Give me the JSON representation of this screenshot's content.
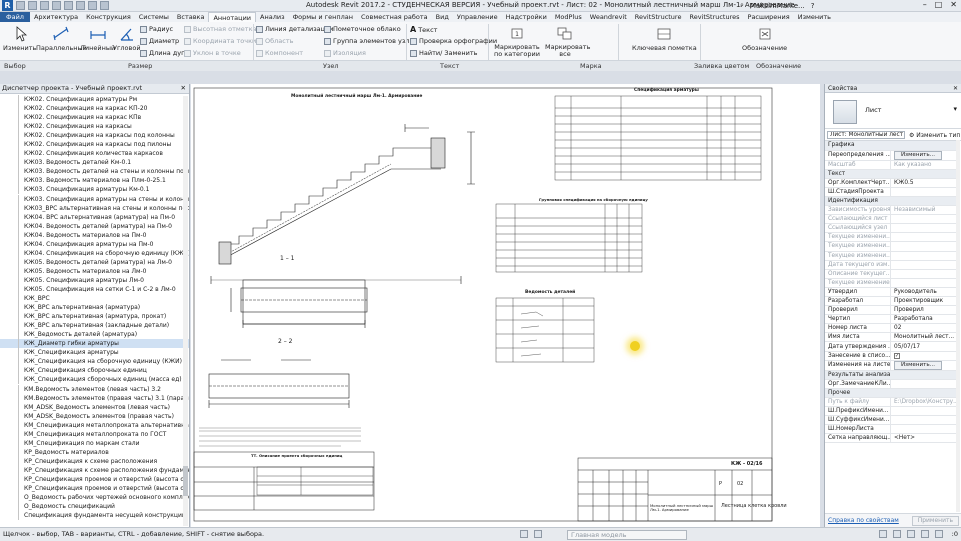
{
  "titlebar": {
    "title": "Autodesk Revit 2017.2 - СТУДЕНЧЕСКАЯ ВЕРСИЯ -    Учебный проект.rvt - Лист: 02 - Монолитный лестничный марш Лм-1. Армирование",
    "search_placeholder": "Введите ключевое слово или фразу",
    "user": "MaksimMarke...",
    "help": "?"
  },
  "tabs": [
    "Файл",
    "Архитектура",
    "Конструкция",
    "Системы",
    "Вставка",
    "Аннотации",
    "Анализ",
    "Формы и генплан",
    "Совместная работа",
    "Вид",
    "Управление",
    "Надстройки",
    "ModPlus",
    "Weandrevit",
    "RevitStructure",
    "RevitStructures",
    "Расширения",
    "Изменить"
  ],
  "active_tab": "Аннотации",
  "ribbon": {
    "modify": "Изменить",
    "parallel": "Параллельный",
    "linear": "Линейный",
    "angular": "Угловой",
    "radius": "Радиус",
    "diameter": "Диаметр",
    "arc_length": "Длина дуги",
    "spot_elevation": "Высотная отметка",
    "spot_coordinate": "Координата точки",
    "spot_slope": "Уклон в точке",
    "area": "Область",
    "component": "Компонент",
    "detail_line": "Линия детализации",
    "revision_cloud": "Пометочное облако",
    "detail_group": "Группа элементов узла",
    "insulation": "Изоляция",
    "text": "Текст",
    "spelling": "Проверка орфографии",
    "find_replace": "Найти/ Заменить",
    "tag_by_category": "Маркировать по категории",
    "tag_all": "Маркировать все",
    "keynote": "Ключевая пометка",
    "legend": "Обозначение"
  },
  "panels": [
    "Выбор",
    "Размер",
    "Узел",
    "Текст",
    "Марка",
    "Заливка цветом",
    "Обозначение"
  ],
  "browser": {
    "title": "Диспетчер проекта - Учебный проект.rvt",
    "selected_index": 27,
    "items": [
      "КЖ02. Спецификация арматуры Рм",
      "КЖ02. Спецификация на каркас КП-20",
      "КЖ02. Спецификация на каркас КПв",
      "КЖ02. Спецификация на каркасы",
      "КЖ02. Спецификация на каркасы под колонны",
      "КЖ02. Спецификация на каркасы под пилоны",
      "КЖ02. Спецификация количества каркасов",
      "КЖ03. Ведомость деталей Км-0.1",
      "КЖ03. Ведомость деталей на стены и колонны подвала",
      "КЖ03. Ведомость материалов на Плм-0-25.1",
      "КЖ03. Спецификация арматуры Км-0.1",
      "КЖ03. Спецификация арматуры на стены и колонны под",
      "КЖ03_ВРС альтернативная на стены и колонны подвал",
      "КЖ04. ВРС альтернативная (арматура) на Пм-0",
      "КЖ04. Ведомость деталей (арматура) на Пм-0",
      "КЖ04. Ведомость материалов на Пм-0",
      "КЖ04. Спецификация арматуры на Пм-0",
      "КЖ04. Спецификация на сборочную единицу (КЖИ) КР-",
      "КЖ05. Ведомость деталей (арматура) на Лм-0",
      "КЖ05. Ведомость материалов на Лм-0",
      "КЖ05. Спецификация арматуры Лм-0",
      "КЖ05. Спецификация на сетки С-1 и С-2 в Лм-0",
      "КЖ_ВРС",
      "КЖ_ВРС альтернативная (арматура)",
      "КЖ_ВРС альтернативная (арматура, прокат)",
      "КЖ_ВРС альтернативная (закладные детали)",
      "КЖ_Ведомость деталей (арматура)",
      "КЖ_Диаметр гибки арматуры",
      "КЖ_Спецификация арматуры",
      "КЖ_Спецификация на сборочную единицу (КЖИ)",
      "КЖ_Спецификация сборочных единиц",
      "КЖ_Спецификация сборочных единиц (масса ед)",
      "КМ.Ведомость элементов (левая часть) 3.2",
      "КМ.Ведомость элементов (правая часть) 3.1 (параметры",
      "КМ_ADSK_Ведомость элементов (левая часть)",
      "КМ_ADSK_Ведомость элементов (правая часть)",
      "КМ_Спецификация металлопроката альтернативная",
      "КМ_Спецификация металлопроката по ГОСТ",
      "КМ_Спецификация по маркам стали",
      "КР_Ведомость материалов",
      "КР_Спецификация к схеме расположения",
      "КР_Спецификация к схеме расположения фундаментов",
      "КР_Спецификация проемов и отверстий (высота от 0.000",
      "КР_Спецификация проемов и отверстий (высота от уров",
      "О_Ведомость рабочих чертежей основного комплекта",
      "О_Ведомость спецификаций",
      "Спецификация фундамента несущей конструкции"
    ]
  },
  "sheet": {
    "stair_title": "Монолитный лестничный марш Лм-1. Армирование",
    "section_1": "1 – 1",
    "section_2": "2 – 2",
    "table1_title": "Спецификация арматуры",
    "table2_title": "Групповая спецификация на сборочную единицу",
    "table3_title": "Ведомость деталей",
    "notes_title": "ТТ. Описание проекта сборочных единиц",
    "stamp_code": "КЖ - 02/16",
    "stamp_sheet_title": "Монолитный лестничный марш Лм-1. Армирование",
    "stamp_name": "Лестница клетка кровли",
    "stamp_stage": "Р",
    "stamp_sheet": "02"
  },
  "properties": {
    "title": "Свойства",
    "type_name": "Лист",
    "instance_selector": "Лист: Монолитный лест",
    "edit_type": "Изменить тип",
    "rows": [
      {
        "group": "Графика"
      },
      {
        "k": "Переопределения ...",
        "btn": "Изменить..."
      },
      {
        "k": "Масштаб",
        "v": "Как указано",
        "dim": true
      },
      {
        "group": "Текст"
      },
      {
        "k": "Орг.КомплектЧерт...",
        "v": "КЖ0.5"
      },
      {
        "k": "Ш.СтадияПроекта",
        "v": ""
      },
      {
        "group": "Идентификация"
      },
      {
        "k": "Зависимость уровня",
        "v": "Независимый",
        "dim": true
      },
      {
        "k": "Ссылающийся лист",
        "v": "",
        "dim": true
      },
      {
        "k": "Ссылающийся узел",
        "v": "",
        "dim": true
      },
      {
        "k": "Текущее изменени...",
        "v": "",
        "dim": true
      },
      {
        "k": "Текущее изменени...",
        "v": "",
        "dim": true
      },
      {
        "k": "Текущее изменени...",
        "v": "",
        "dim": true
      },
      {
        "k": "Дата текущего изм...",
        "v": "",
        "dim": true
      },
      {
        "k": "Описание текущег...",
        "v": "",
        "dim": true
      },
      {
        "k": "Текущее изменение",
        "v": "",
        "dim": true
      },
      {
        "k": "Утвердил",
        "v": "Руководитель"
      },
      {
        "k": "Разработал",
        "v": "Проектировщик"
      },
      {
        "k": "Проверил",
        "v": "Проверил"
      },
      {
        "k": "Чертил",
        "v": "Разработала"
      },
      {
        "k": "Номер листа",
        "v": "02"
      },
      {
        "k": "Имя листа",
        "v": "Монолитный лест..."
      },
      {
        "k": "Дата утверждения ...",
        "v": "05/07/17"
      },
      {
        "k": "Занесение в списо...",
        "check": true
      },
      {
        "k": "Изменения на листе",
        "btn": "Изменить..."
      },
      {
        "group": "Результаты анализа"
      },
      {
        "k": "Орг.ЗамечаниеКЛи...",
        "v": ""
      },
      {
        "group": "Прочее"
      },
      {
        "k": "Путь к файлу",
        "v": "E:\\Dropbox\\Констру...",
        "dim": true
      },
      {
        "k": "Ш.ПрефиксИмени...",
        "v": ""
      },
      {
        "k": "Ш.СуффиксИмени...",
        "v": ""
      },
      {
        "k": "Ш.НомерЛиста",
        "v": ""
      },
      {
        "k": "Сетка направляющ...",
        "v": "<Нет>"
      }
    ],
    "help_link": "Справка по свойствам",
    "apply": "Применить"
  },
  "status": {
    "message": "Щелчок - выбор, TAB - варианты, CTRL - добавление, SHIFT - снятие выбора.",
    "model": "Главная модель",
    "filter": ":0"
  }
}
